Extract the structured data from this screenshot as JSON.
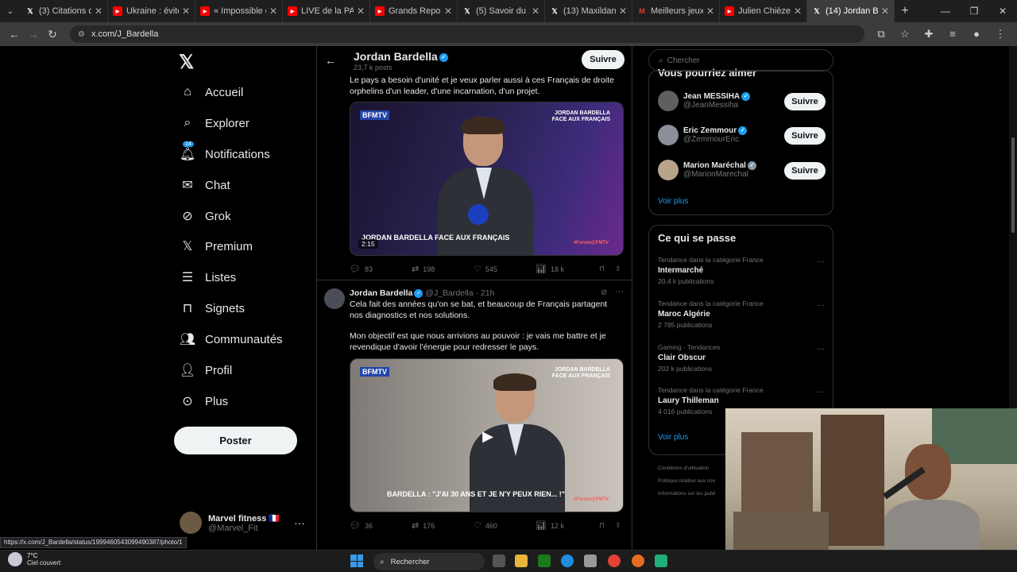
{
  "browser": {
    "tabs": [
      {
        "label": "(3) Citations de c",
        "icon": "x-logo-icon"
      },
      {
        "label": "Ukraine : éviter la",
        "icon": "youtube-icon"
      },
      {
        "label": "« Impossible d'êt",
        "icon": "youtube-icon"
      },
      {
        "label": "LIVE de la PASSIO",
        "icon": "youtube-icon"
      },
      {
        "label": "Grands Reportage",
        "icon": "youtube-icon"
      },
      {
        "label": "(5) Savoir du Mon",
        "icon": "x-logo-icon"
      },
      {
        "label": "(13) Maxildan sur",
        "icon": "x-logo-icon"
      },
      {
        "label": "Meilleurs jeux de",
        "icon": "m-logo-icon"
      },
      {
        "label": "Julien Chièze - Yo",
        "icon": "youtube-icon"
      },
      {
        "label": "(14) Jordan Bardel",
        "icon": "x-logo-icon"
      }
    ],
    "url": "x.com/J_Bardella",
    "status_url": "https://x.com/J_Bardella/status/1999460543099490387/photo/1"
  },
  "nav": {
    "items": [
      {
        "label": "Accueil",
        "icon": "home-icon"
      },
      {
        "label": "Explorer",
        "icon": "search-icon"
      },
      {
        "label": "Notifications",
        "icon": "bell-icon"
      },
      {
        "label": "Chat",
        "icon": "mail-icon"
      },
      {
        "label": "Grok",
        "icon": "grok-icon"
      },
      {
        "label": "Premium",
        "icon": "x-logo-icon"
      },
      {
        "label": "Listes",
        "icon": "list-icon"
      },
      {
        "label": "Signets",
        "icon": "bookmark-icon"
      },
      {
        "label": "Communautés",
        "icon": "people-icon"
      },
      {
        "label": "Profil",
        "icon": "person-icon"
      },
      {
        "label": "Plus",
        "icon": "more-circle-icon"
      }
    ],
    "notifications_badge": "14",
    "post_label": "Poster",
    "account": {
      "name": "Marvel fitness 🇫🇷",
      "handle": "@Marvel_Fit"
    }
  },
  "profile": {
    "name": "Jordan Bardella",
    "posts_count": "23,7 k posts",
    "follow_label": "Suivre"
  },
  "tweets": [
    {
      "text": "Le pays a besoin d'unité et je veux parler aussi à ces Français de droite orphelins d'un leader, d'une incarnation, d'un projet.",
      "video": {
        "channel": "BFMTV",
        "banner": "JORDAN BARDELLA FACE AUX FRANÇAIS",
        "caption": "JORDAN BARDELLA FACE AUX FRANÇAIS",
        "duration": "2:15",
        "tag": "#Forum@FMTV"
      },
      "replies": "83",
      "reposts": "198",
      "likes": "545",
      "views": "18 k"
    },
    {
      "author": "Jordan Bardella",
      "handle": "@J_Bardella",
      "time": "· 21h",
      "text1": "Cela fait des années qu'on se bat, et beaucoup de Français partagent nos diagnostics et nos solutions.",
      "text2": "Mon objectif est que nous arrivions au pouvoir : je vais me battre et je revendique d'avoir l'énergie pour redresser le pays.",
      "video": {
        "channel": "BFMTV",
        "banner": "JORDAN BARDELLA FACE AUX FRANÇAIS",
        "caption": "BARDELLA : \"J'AI 30 ANS ET JE N'Y PEUX RIEN... !\"",
        "tag": "#Forum@FMTV"
      },
      "replies": "36",
      "reposts": "176",
      "likes": "460",
      "views": "12 k"
    }
  ],
  "right": {
    "search_placeholder": "Chercher",
    "suggest_title": "Vous pourriez aimer",
    "suggestions": [
      {
        "name": "Jean MESSIHA",
        "handle": "@JeanMessiha",
        "button": "Suivre",
        "badge": "blue"
      },
      {
        "name": "Eric Zemmour",
        "handle": "@ZemmourEric",
        "button": "Suivre",
        "badge": "blue"
      },
      {
        "name": "Marion Maréchal",
        "handle": "@MarionMarechal",
        "button": "Suivre",
        "badge": "grey"
      }
    ],
    "see_more": "Voir plus",
    "trends_title": "Ce qui se passe",
    "trends": [
      {
        "category": "Tendance dans la catégorie France",
        "title": "Intermarché",
        "count": "20,4 k publications"
      },
      {
        "category": "Tendance dans la catégorie France",
        "title": "Maroc Algérie",
        "count": "2 785 publications"
      },
      {
        "category": "Gaming · Tendances",
        "title": "Clair Obscur",
        "count": "202 k publications"
      },
      {
        "category": "Tendance dans la catégorie France",
        "title": "Laury Thilleman",
        "count": "4 016 publications"
      }
    ],
    "trends_more": "Voir plus",
    "footer": [
      "Conditions d'utilisation",
      "Politique relative aux coo",
      "Informations sur les publi"
    ]
  },
  "taskbar": {
    "temperature": "7°C",
    "weather": "Ciel couvert",
    "search_label": "Rechercher"
  },
  "colors": {
    "accent": "#1d9bf0",
    "background": "#000000",
    "text": "#e7e9ea",
    "muted": "#71767b"
  }
}
